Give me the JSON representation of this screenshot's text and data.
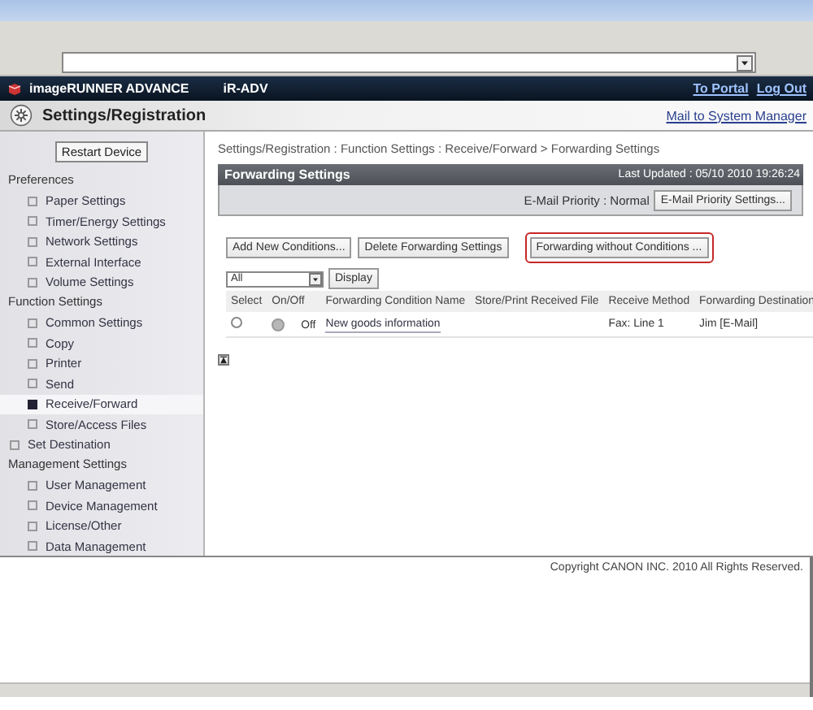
{
  "header": {
    "product": "imageRUNNER ADVANCE",
    "device": "iR-ADV",
    "links": [
      "To Portal",
      "Log Out"
    ]
  },
  "title_band": {
    "title": "Settings/Registration",
    "link": "Mail to System Manager"
  },
  "sidebar": {
    "restart_button": "Restart Device",
    "items": [
      {
        "kind": "heading",
        "label": "Preferences",
        "children": [
          {
            "label": "Paper Settings",
            "selected": false
          },
          {
            "label": "Timer/Energy Settings",
            "selected": false
          },
          {
            "label": "Network Settings",
            "selected": false
          },
          {
            "label": "External Interface",
            "selected": false
          },
          {
            "label": "Volume Settings",
            "selected": false
          }
        ]
      },
      {
        "kind": "heading",
        "label": "Function Settings",
        "children": [
          {
            "label": "Common Settings",
            "selected": false
          },
          {
            "label": "Copy",
            "selected": false
          },
          {
            "label": "Printer",
            "selected": false
          },
          {
            "label": "Send",
            "selected": false
          },
          {
            "label": "Receive/Forward",
            "selected": true
          },
          {
            "label": "Store/Access Files",
            "selected": false
          }
        ]
      },
      {
        "kind": "item",
        "label": "Set Destination",
        "selected": false
      },
      {
        "kind": "heading",
        "label": "Management Settings",
        "children": [
          {
            "label": "User Management",
            "selected": false
          },
          {
            "label": "Device Management",
            "selected": false
          },
          {
            "label": "License/Other",
            "selected": false
          },
          {
            "label": "Data Management",
            "selected": false
          }
        ]
      }
    ]
  },
  "breadcrumb": "Settings/Registration : Function Settings : Receive/Forward > Forwarding Settings",
  "panel": {
    "title": "Forwarding Settings",
    "last_updated": "Last Updated : 05/10 2010 19:26:24",
    "priority_label": "E-Mail Priority : Normal",
    "priority_button": "E-Mail Priority Settings..."
  },
  "actions": [
    {
      "label": "Add New Conditions...",
      "highlighted": false
    },
    {
      "label": "Delete Forwarding Settings",
      "highlighted": false
    },
    {
      "label": "Forwarding without Conditions ...",
      "highlighted": true
    }
  ],
  "filter": {
    "value": "All",
    "button": "Display"
  },
  "table": {
    "columns": [
      "Select",
      "On/Off",
      "Forwarding Condition Name",
      "Store/Print Received File",
      "Receive Method",
      "Forwarding Destination"
    ],
    "rows": [
      {
        "checked": false,
        "on": false,
        "state_text": "Off",
        "name": "New goods information",
        "receive_method": "Fax: Line 1",
        "destination": "Jim [E-Mail]"
      }
    ]
  },
  "copyright": "Copyright CANON INC. 2010 All Rights Reserved."
}
